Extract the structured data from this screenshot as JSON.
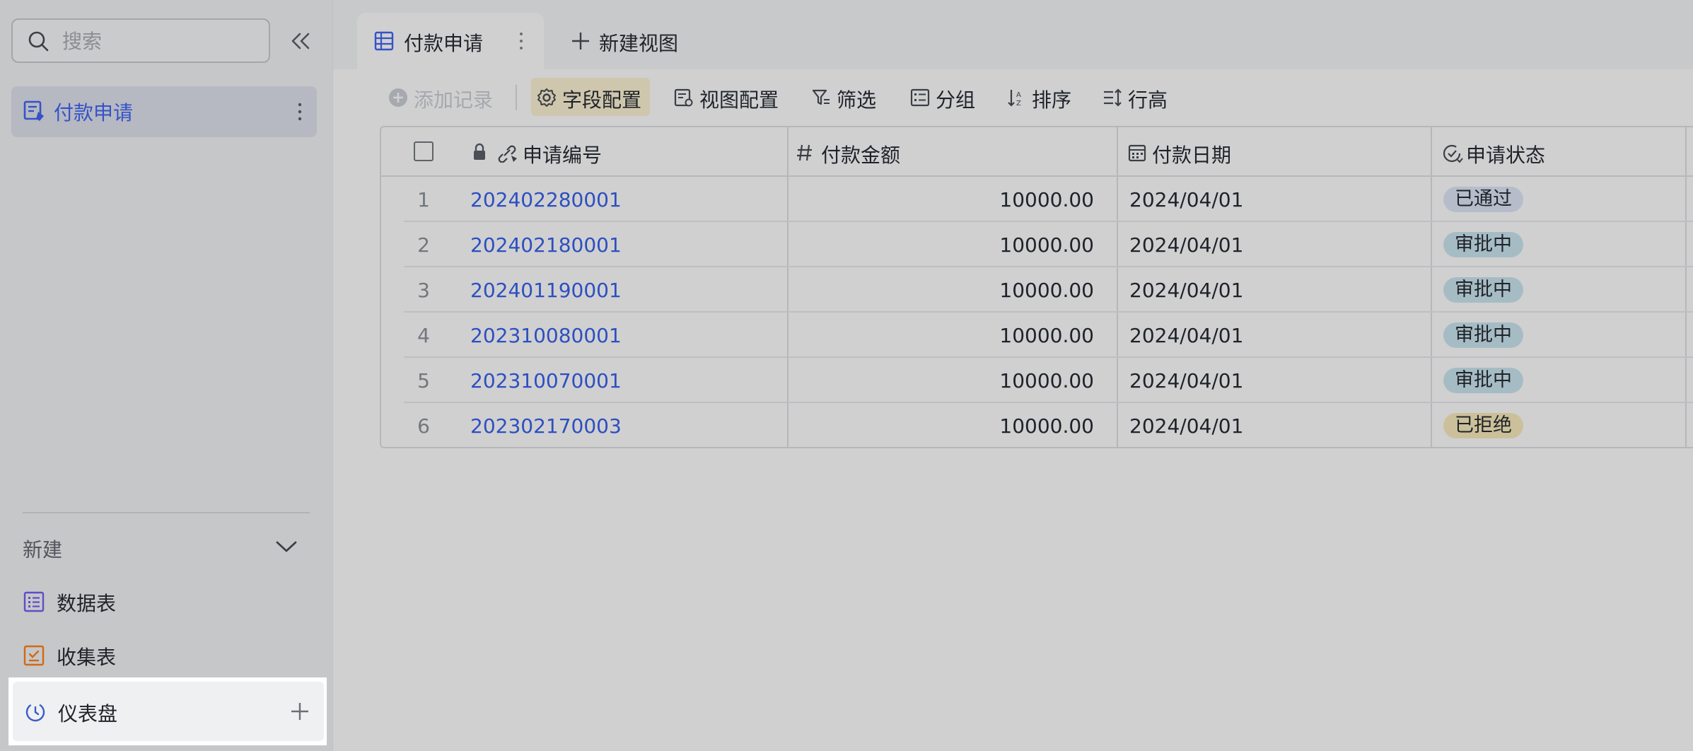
{
  "sidebar": {
    "search_placeholder": "搜索",
    "items": [
      {
        "label": "付款申请"
      }
    ],
    "new_section": {
      "label": "新建",
      "items": [
        {
          "label": "数据表",
          "icon": "table-icon",
          "color": "#5b4fc9"
        },
        {
          "label": "收集表",
          "icon": "form-icon",
          "color": "#d06a18"
        },
        {
          "label": "仪表盘",
          "icon": "dashboard-icon",
          "color": "#3a5ccc"
        }
      ]
    }
  },
  "tabs": {
    "active": {
      "label": "付款申请"
    },
    "new_view_label": "新建视图"
  },
  "toolbar": {
    "add_record": "添加记录",
    "field_config": "字段配置",
    "view_config": "视图配置",
    "filter": "筛选",
    "group": "分组",
    "sort": "排序",
    "row_height": "行高"
  },
  "table": {
    "columns": [
      "申请编号",
      "付款金额",
      "付款日期",
      "申请状态"
    ],
    "rows": [
      {
        "num": "1",
        "code": "202402280001",
        "amount": "10000.00",
        "date": "2024/04/01",
        "status": "已通过",
        "status_kind": "passed"
      },
      {
        "num": "2",
        "code": "202402180001",
        "amount": "10000.00",
        "date": "2024/04/01",
        "status": "审批中",
        "status_kind": "pending"
      },
      {
        "num": "3",
        "code": "202401190001",
        "amount": "10000.00",
        "date": "2024/04/01",
        "status": "审批中",
        "status_kind": "pending"
      },
      {
        "num": "4",
        "code": "202310080001",
        "amount": "10000.00",
        "date": "2024/04/01",
        "status": "审批中",
        "status_kind": "pending"
      },
      {
        "num": "5",
        "code": "202310070001",
        "amount": "10000.00",
        "date": "2024/04/01",
        "status": "审批中",
        "status_kind": "pending"
      },
      {
        "num": "6",
        "code": "202302170003",
        "amount": "10000.00",
        "date": "2024/04/01",
        "status": "已拒绝",
        "status_kind": "rejected"
      }
    ]
  },
  "colors": {
    "accent": "#3453c7",
    "status_passed": "#b7bccb",
    "status_pending": "#a6bcc4",
    "status_rejected": "#ccc09a"
  }
}
